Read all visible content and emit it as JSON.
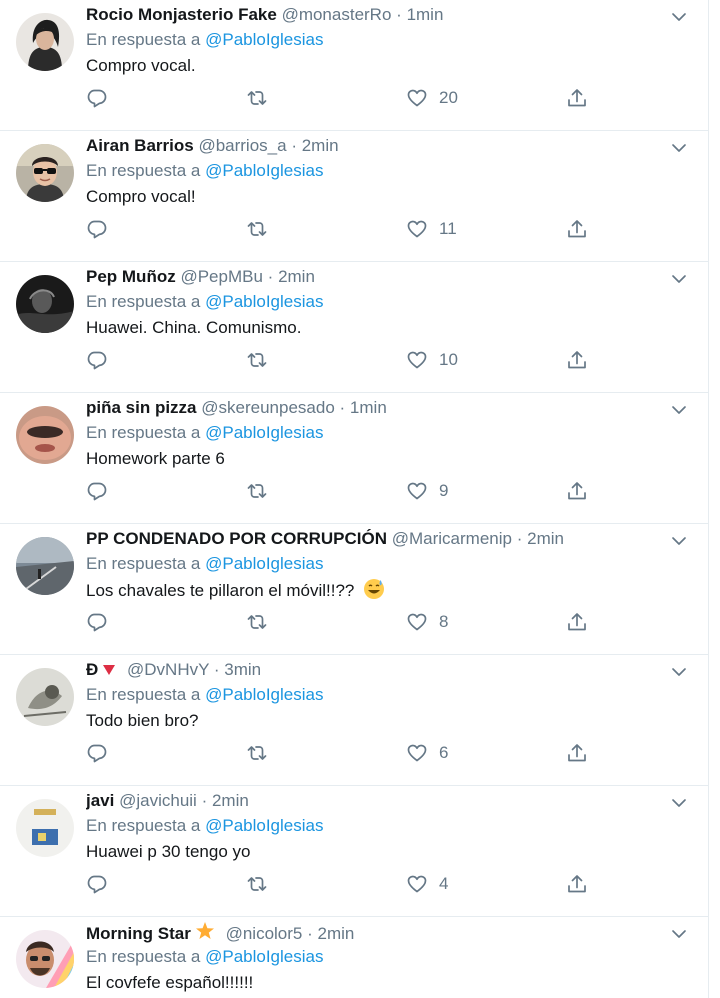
{
  "reply_prefix": "En respuesta a",
  "colors": {
    "link": "#1b95e0",
    "muted": "#657786",
    "text": "#14171a",
    "border": "#e6ecf0"
  },
  "tweets": [
    {
      "name": "Rocio Monjasterio Fake",
      "handle": "@monasterRo",
      "dot": "·",
      "time": "1min",
      "mention": "@PabloIglesias",
      "text": "Compro vocal.",
      "likes": "20",
      "avatar_icon": "woman-portrait"
    },
    {
      "name": "Airan Barrios",
      "handle": "@barrios_a",
      "dot": "·",
      "time": "2min",
      "mention": "@PabloIglesias",
      "text": "Compro vocal!",
      "likes": "11",
      "avatar_icon": "man-sunglasses"
    },
    {
      "name": "Pep Muñoz",
      "handle": "@PepMBu",
      "dot": "·",
      "time": "2min",
      "mention": "@PabloIglesias",
      "text": "Huawei. China. Comunismo.",
      "likes": "10",
      "avatar_icon": "dark-photo"
    },
    {
      "name": "piña sin pizza",
      "handle": "@skereunpesado",
      "dot": "·",
      "time": "1min",
      "mention": "@PabloIglesias",
      "text": "Homework parte 6",
      "likes": "9",
      "avatar_icon": "face-closeup"
    },
    {
      "name": "PP CONDENADO POR CORRUPCIÓN",
      "handle": "@Maricarmenip",
      "dot": "·",
      "time": "2min",
      "mention": "@PabloIglesias",
      "text": "Los chavales te pillaron el móvil!!??",
      "likes": "8",
      "avatar_icon": "landscape",
      "emoji": "grinning-sweat-emoji"
    },
    {
      "name": "Ð",
      "handle": "@DvNHvY",
      "dot": "·",
      "time": "3min",
      "mention": "@PabloIglesias",
      "text": "Todo bien bro?",
      "likes": "6",
      "avatar_icon": "sketch",
      "badge": "red-triangle-icon"
    },
    {
      "name": "javi",
      "handle": "@javichuii",
      "dot": "·",
      "time": "2min",
      "mention": "@PabloIglesias",
      "text": "Huawei p 30 tengo yo",
      "likes": "4",
      "avatar_icon": "light-photo"
    },
    {
      "name": "Morning Star",
      "handle": "@nicolor5",
      "dot": "·",
      "time": "2min",
      "mention": "@PabloIglesias",
      "text": "El covfefe español!!!!!!",
      "likes": "",
      "avatar_icon": "man-rainbow",
      "badge": "star-icon"
    }
  ]
}
